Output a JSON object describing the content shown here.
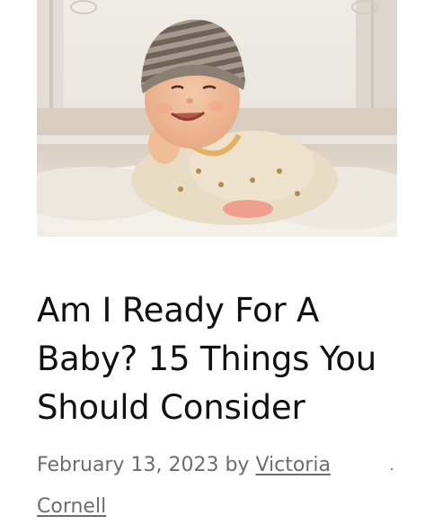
{
  "post": {
    "title": "Am I Ready For A Baby? 15 Things You Should Consider",
    "date": "February 13, 2023",
    "by": "by",
    "author": "Victoria Cornell"
  },
  "image": {
    "subject": "smiling baby in striped knit hat lying on fluffy white rug"
  },
  "colors": {
    "title": "#111111",
    "meta": "#6d6d6d",
    "accent_dot": "#3b8dd9"
  }
}
